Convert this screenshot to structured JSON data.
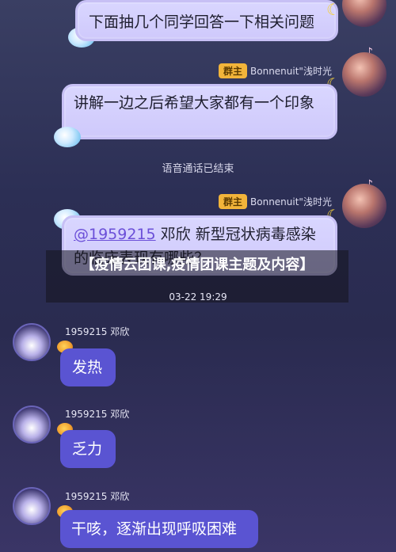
{
  "messages": [
    {
      "text": "下面抽几个同学回答一下相关问题"
    },
    {
      "text": "讲解一边之后希望大家都有一个印象"
    },
    {
      "mention": "@1959215",
      "text": " 邓欣 新型冠状病毒感染的临床表现有哪些？"
    }
  ],
  "owner": {
    "badge": "群主",
    "name": "Bonnenuit\"浅时光"
  },
  "system": {
    "voice_ended": "语音通话已结束",
    "time": "03-22 19:29"
  },
  "overlay_title": "【疫情云团课,疫情团课主题及内容】",
  "member": {
    "name": "1959215 邓欣"
  },
  "replies": [
    {
      "text": "发热"
    },
    {
      "text": "乏力"
    },
    {
      "text": "干咳，逐渐出现呼吸困难"
    }
  ],
  "icons": {
    "moon": "moon-icon",
    "note": "music-note-icon",
    "planet": "planet-icon"
  }
}
